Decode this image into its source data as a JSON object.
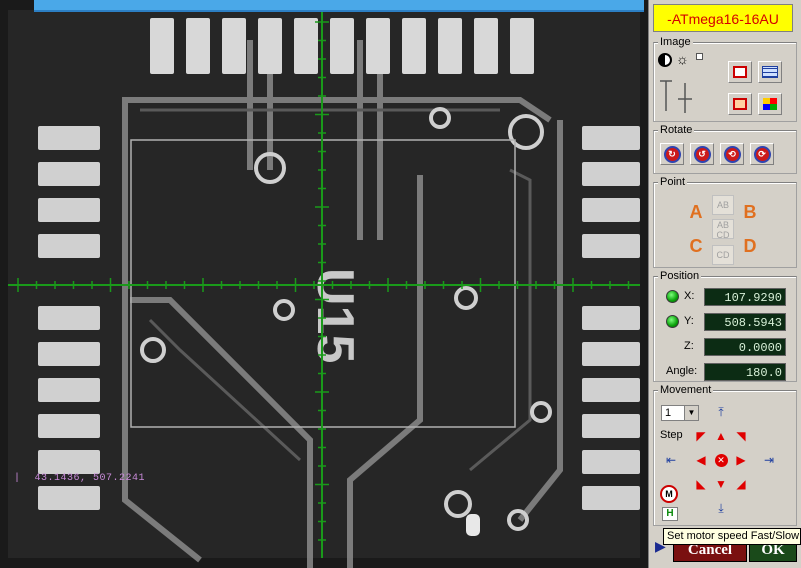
{
  "camera": {
    "coord_readout": "43.1436, 507.2241",
    "board_label": "U15"
  },
  "panel": {
    "chip_name": "-ATmega16-16AU",
    "image": {
      "title": "Image"
    },
    "rotate": {
      "title": "Rotate",
      "buttons": [
        "rotate-cw-90",
        "rotate-ccw-90",
        "rotate-180",
        "rotate-reset"
      ]
    },
    "point": {
      "title": "Point",
      "a": "A",
      "b": "B",
      "c": "C",
      "d": "D",
      "ab": "AB",
      "abcd_top": "AB",
      "abcd_bottom": "CD",
      "cd": "CD"
    },
    "position": {
      "title": "Position",
      "x_label": "X:",
      "x_value": "107.9290",
      "y_label": "Y:",
      "y_value": "508.5943",
      "z_label": "Z:",
      "z_value": "0.0000",
      "angle_label": "Angle:",
      "angle_value": "180.0"
    },
    "movement": {
      "title": "Movement",
      "step_value": "1",
      "step_label": "Step",
      "motor_label": "M",
      "home_label": "H"
    }
  },
  "buttons": {
    "cancel": "Cancel",
    "ok": "OK"
  },
  "tooltip": "Set motor speed Fast/Slow",
  "colors": {
    "crosshair": "#1a9a1a",
    "chip_bg": "#ffff00",
    "chip_text": "#d40000",
    "point_letter": "#e07020",
    "arrow": "#e00000",
    "readout_bg": "#0c2c14"
  }
}
